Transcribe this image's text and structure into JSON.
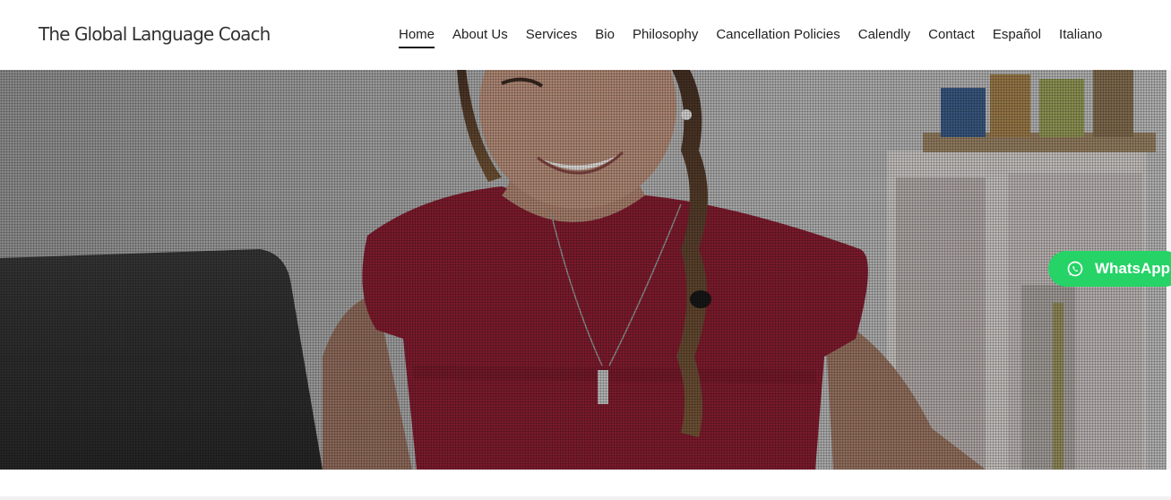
{
  "site": {
    "title": "The Global Language Coach"
  },
  "nav": {
    "items": [
      {
        "label": "Home",
        "active": true
      },
      {
        "label": "About Us"
      },
      {
        "label": "Services"
      },
      {
        "label": "Bio"
      },
      {
        "label": "Philosophy"
      },
      {
        "label": "Cancellation Policies"
      },
      {
        "label": "Calendly"
      },
      {
        "label": "Contact"
      },
      {
        "label": "Español"
      },
      {
        "label": "Italiano"
      }
    ]
  },
  "hero": {
    "image": "woman-smiling-at-laptop-photo"
  },
  "whatsapp": {
    "label": "WhatsApp",
    "icon": "whatsapp-icon",
    "color": "#25d366"
  }
}
